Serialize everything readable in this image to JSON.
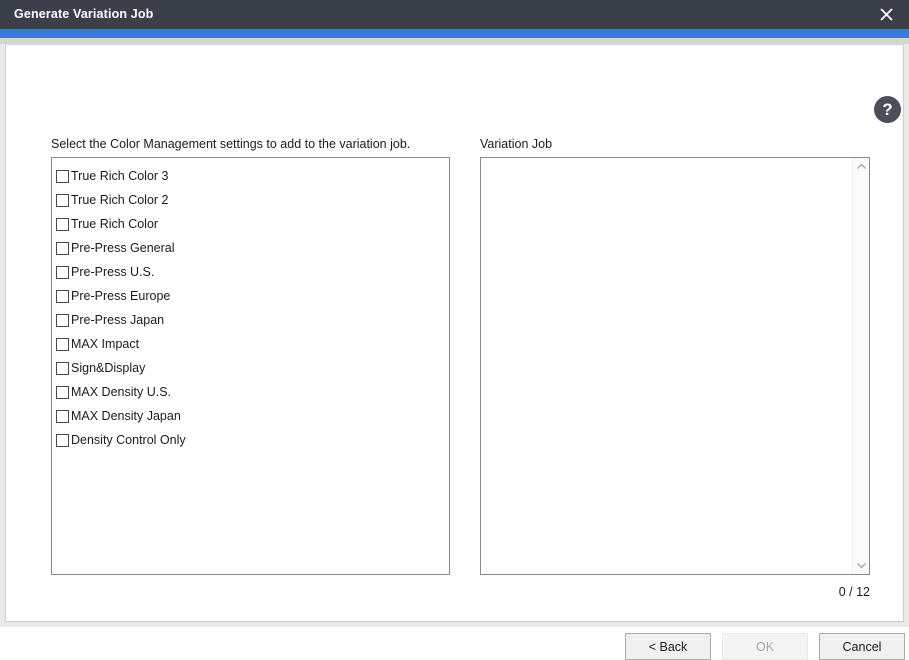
{
  "window": {
    "title": "Generate Variation Job",
    "close_icon": "close-icon",
    "accent_color": "#3b78e0",
    "titlebar_color": "#3b3f4a"
  },
  "help": {
    "glyph": "?",
    "name": "help-icon"
  },
  "left_panel": {
    "label": "Select the Color Management settings to add to the variation job.",
    "items": [
      {
        "label": "True Rich Color 3",
        "checked": false
      },
      {
        "label": "True Rich Color 2",
        "checked": false
      },
      {
        "label": "True Rich Color",
        "checked": false
      },
      {
        "label": "Pre-Press General",
        "checked": false
      },
      {
        "label": "Pre-Press U.S.",
        "checked": false
      },
      {
        "label": "Pre-Press Europe",
        "checked": false
      },
      {
        "label": "Pre-Press Japan",
        "checked": false
      },
      {
        "label": "MAX Impact",
        "checked": false
      },
      {
        "label": "Sign&Display",
        "checked": false
      },
      {
        "label": "MAX Density U.S.",
        "checked": false
      },
      {
        "label": "MAX Density Japan",
        "checked": false
      },
      {
        "label": "Density Control Only",
        "checked": false
      }
    ]
  },
  "right_panel": {
    "label": "Variation Job",
    "items": [],
    "scroll_up_icon": "chevron-up-icon",
    "scroll_down_icon": "chevron-down-icon"
  },
  "counter": {
    "text": "0 / 12"
  },
  "buttons": {
    "back": "< Back",
    "ok": "OK",
    "cancel": "Cancel"
  }
}
